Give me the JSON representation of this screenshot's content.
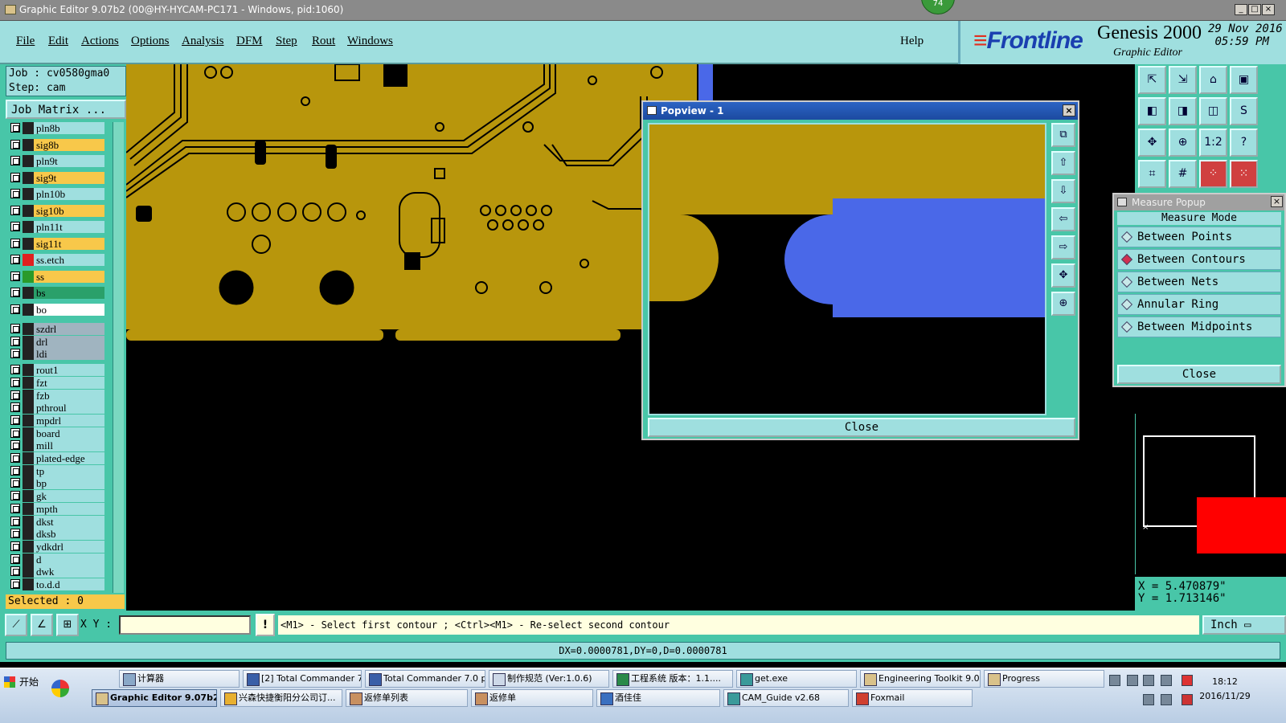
{
  "titlebar": {
    "title": "Graphic Editor 9.07b2 (00@HY-HYCAM-PC171 - Windows, pid:1060)",
    "badge": "74",
    "buttons": [
      "_",
      "□",
      "×"
    ]
  },
  "menu": {
    "items": [
      "File",
      "Edit",
      "Actions",
      "Options",
      "Analysis",
      "DFM",
      "Step",
      "Rout",
      "Windows"
    ],
    "help": "Help"
  },
  "brand": {
    "logo": "Frontline",
    "product": "Genesis 2000",
    "subtitle": "Graphic Editor",
    "date": "29 Nov 2016",
    "time": "05:59 PM"
  },
  "job": {
    "job_line": "Job : cv0580gma0",
    "step_line": "Step: cam",
    "matrix_button": "Job Matrix ..."
  },
  "layers": [
    {
      "name": "pln8b",
      "color": "#222222",
      "bg": "#9fdfdf"
    },
    {
      "name": "sig8b",
      "color": "#222222",
      "bg": "#f8c84a"
    },
    {
      "name": "pln9t",
      "color": "#222222",
      "bg": "#9fdfdf"
    },
    {
      "name": "sig9t",
      "color": "#222222",
      "bg": "#f8c84a"
    },
    {
      "name": "pln10b",
      "color": "#222222",
      "bg": "#9fdfdf"
    },
    {
      "name": "sig10b",
      "color": "#222222",
      "bg": "#f8c84a"
    },
    {
      "name": "pln11t",
      "color": "#222222",
      "bg": "#9fdfdf"
    },
    {
      "name": "sig11t",
      "color": "#222222",
      "bg": "#f8c84a"
    },
    {
      "name": "ss.etch",
      "color": "#e02020",
      "bg": "#9fdfdf"
    },
    {
      "name": "ss",
      "color": "#2a9a2a",
      "bg": "#f8c84a"
    },
    {
      "name": "bs",
      "color": "#222222",
      "bg": "#2aa06a"
    },
    {
      "name": "bo",
      "color": "#222222",
      "bg": "#ffffff"
    },
    {
      "name": "szdrl",
      "color": "#222222",
      "bg": "#a0b4c0"
    },
    {
      "name": "drl",
      "color": "#222222",
      "bg": "#a0b4c0"
    },
    {
      "name": "ldi",
      "color": "#222222",
      "bg": "#a0b4c0"
    },
    {
      "name": "rout1",
      "color": "#222222",
      "bg": "#9fdfdf"
    },
    {
      "name": "fzt",
      "color": "#222222",
      "bg": "#9fdfdf"
    },
    {
      "name": "fzb",
      "color": "#222222",
      "bg": "#9fdfdf"
    },
    {
      "name": "pthroul",
      "color": "#222222",
      "bg": "#9fdfdf"
    },
    {
      "name": "mpdrl",
      "color": "#222222",
      "bg": "#9fdfdf"
    },
    {
      "name": "board",
      "color": "#222222",
      "bg": "#9fdfdf"
    },
    {
      "name": "mill",
      "color": "#222222",
      "bg": "#9fdfdf"
    },
    {
      "name": "plated-edge",
      "color": "#222222",
      "bg": "#9fdfdf"
    },
    {
      "name": "tp",
      "color": "#222222",
      "bg": "#9fdfdf"
    },
    {
      "name": "bp",
      "color": "#222222",
      "bg": "#9fdfdf"
    },
    {
      "name": "gk",
      "color": "#222222",
      "bg": "#9fdfdf"
    },
    {
      "name": "mpth",
      "color": "#222222",
      "bg": "#9fdfdf"
    },
    {
      "name": "dkst",
      "color": "#222222",
      "bg": "#9fdfdf"
    },
    {
      "name": "dksb",
      "color": "#222222",
      "bg": "#9fdfdf"
    },
    {
      "name": "ydkdrl",
      "color": "#222222",
      "bg": "#9fdfdf"
    },
    {
      "name": "d",
      "color": "#222222",
      "bg": "#9fdfdf"
    },
    {
      "name": "dwk",
      "color": "#222222",
      "bg": "#9fdfdf"
    },
    {
      "name": "to.d.d",
      "color": "#222222",
      "bg": "#9fdfdf"
    }
  ],
  "selected": "Selected : 0",
  "popview": {
    "title": "Popview - 1",
    "close": "Close"
  },
  "measure": {
    "title": "Measure Popup",
    "mode_label": "Measure Mode",
    "options": [
      {
        "label": "Between Points",
        "selected": false
      },
      {
        "label": "Between Contours",
        "selected": true
      },
      {
        "label": "Between Nets",
        "selected": false
      },
      {
        "label": "Annular Ring",
        "selected": false
      },
      {
        "label": "Between Midpoints",
        "selected": false
      }
    ],
    "close": "Close"
  },
  "coords": {
    "x": "X = 5.470879\"",
    "y": "Y = 1.713146\""
  },
  "command": {
    "xy_label": "X Y :",
    "xy_value": "",
    "warn": "!",
    "prompt": "<M1> - Select first contour ; <Ctrl><M1> - Re-select second contour",
    "unit": "Inch"
  },
  "status": "DX=0.0000781,DY=0,D=0.0000781",
  "taskbar": {
    "start": "开始",
    "row1": [
      {
        "label": "计算器",
        "icon": "#8aa8c8"
      },
      {
        "label": "[2] Total Commander 7....",
        "icon": "#3a5fa8"
      },
      {
        "label": "Total Commander 7.0 p...",
        "icon": "#3a5fa8"
      },
      {
        "label": "制作规范 (Ver:1.0.6)",
        "icon": "#cdd8e8"
      },
      {
        "label": "工程系统  版本：1.1....",
        "icon": "#2a8a4a"
      },
      {
        "label": "get.exe",
        "icon": "#3a9a9a"
      },
      {
        "label": "Engineering Toolkit 9.0...",
        "icon": "#d9c28a"
      },
      {
        "label": "Progress",
        "icon": "#d9c28a"
      }
    ],
    "row2": [
      {
        "label": "Graphic Editor 9.07b2 ...",
        "icon": "#d9c28a",
        "active": true
      },
      {
        "label": "兴森快捷衡阳分公司订...",
        "icon": "#e8b030"
      },
      {
        "label": "返修单列表",
        "icon": "#c89060"
      },
      {
        "label": "返修单",
        "icon": "#c89060"
      },
      {
        "label": "酒佳佳",
        "icon": "#3a70c0"
      },
      {
        "label": "CAM_Guide v2.68",
        "icon": "#3a9a9a"
      },
      {
        "label": "Foxmail",
        "icon": "#d04030"
      }
    ],
    "clock_time": "18:12",
    "clock_date": "2016/11/29"
  }
}
